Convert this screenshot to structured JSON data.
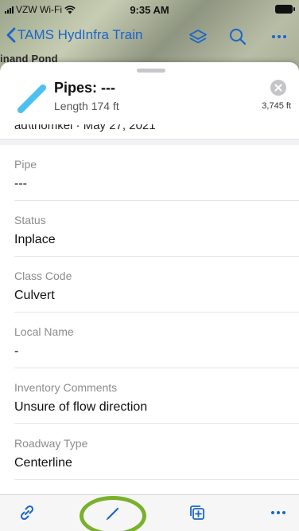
{
  "status_bar": {
    "carrier": "VZW Wi-Fi",
    "time": "9:35 AM"
  },
  "nav": {
    "back_label": "TAMS HydInfra Train",
    "icons": [
      "layers-icon",
      "search-icon",
      "more-icon"
    ]
  },
  "map": {
    "label": "inand Pond"
  },
  "sheet": {
    "title": "Pipes: ---",
    "subtitle": "Length 174 ft",
    "distance": "3,745 ft",
    "partial_row": "ad\\thomkel · May 27, 2021"
  },
  "fields": [
    {
      "label": "Pipe",
      "value": "---"
    },
    {
      "label": "Status",
      "value": "Inplace"
    },
    {
      "label": "Class Code",
      "value": "Culvert"
    },
    {
      "label": "Local Name",
      "value": "-"
    },
    {
      "label": "Inventory Comments",
      "value": "Unsure of flow direction"
    },
    {
      "label": "Roadway Type",
      "value": "Centerline"
    }
  ],
  "toolbar": {
    "buttons": [
      "link-icon",
      "edit-pencil-icon",
      "add-copy-icon",
      "more-icon"
    ],
    "highlighted": "edit-pencil-icon"
  },
  "colors": {
    "accent": "#1a66c7",
    "feature_line": "#4cc0f0",
    "highlight": "#79b12a"
  }
}
